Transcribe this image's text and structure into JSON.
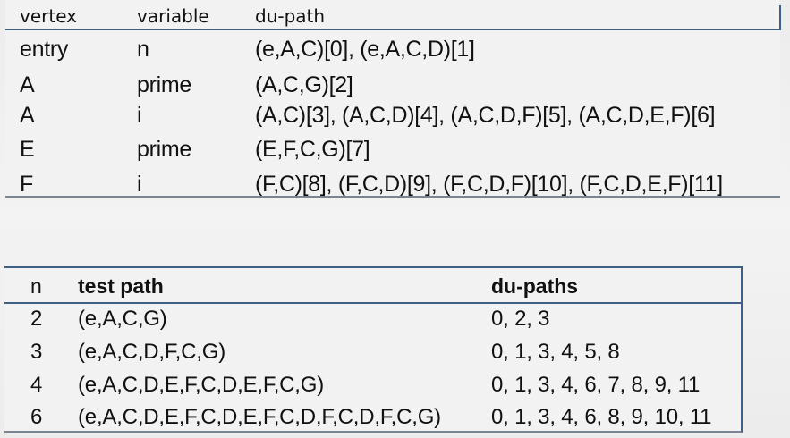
{
  "du_table": {
    "headers": {
      "vertex": "vertex",
      "variable": "variable",
      "du_path": "du-path"
    },
    "rows": [
      {
        "vertex": "entry",
        "variable": "n",
        "du_path": "(e,A,C)[0], (e,A,C,D)[1]"
      },
      {
        "vertex": "A",
        "variable": "prime",
        "du_path": "(A,C,G)[2]"
      },
      {
        "vertex": "A",
        "variable": "i",
        "du_path": "(A,C)[3], (A,C,D)[4], (A,C,D,F)[5], (A,C,D,E,F)[6]"
      },
      {
        "vertex": "E",
        "variable": "prime",
        "du_path": "(E,F,C,G)[7]"
      },
      {
        "vertex": "F",
        "variable": "i",
        "du_path": "(F,C)[8], (F,C,D)[9], (F,C,D,F)[10], (F,C,D,E,F)[11]"
      }
    ]
  },
  "test_table": {
    "headers": {
      "n": "n",
      "test_path": "test path",
      "du_paths": "du-paths"
    },
    "rows": [
      {
        "n": "2",
        "test_path": "(e,A,C,G)",
        "du_paths": "0, 2, 3"
      },
      {
        "n": "3",
        "test_path": "(e,A,C,D,F,C,G)",
        "du_paths": "0, 1, 3, 4, 5, 8"
      },
      {
        "n": "4",
        "test_path": "(e,A,C,D,E,F,C,D,E,F,C,G)",
        "du_paths": "0, 1, 3, 4, 6, 7, 8, 9, 11"
      },
      {
        "n": "6",
        "test_path": "(e,A,C,D,E,F,C,D,E,F,C,D,F,C,D,F,C,G)",
        "du_paths": "0, 1, 3, 4, 6, 8, 9, 10, 11"
      }
    ]
  }
}
